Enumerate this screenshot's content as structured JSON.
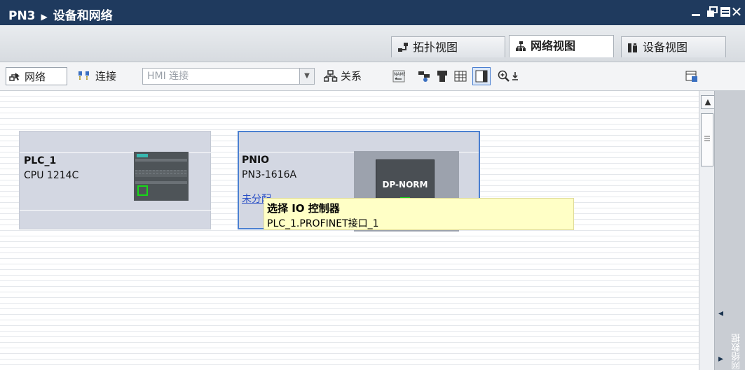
{
  "breadcrumb": {
    "project": "PN3",
    "page": "设备和网络"
  },
  "tabs": [
    {
      "label": "拓扑视图",
      "active": false
    },
    {
      "label": "网络视图",
      "active": true
    },
    {
      "label": "设备视图",
      "active": false
    }
  ],
  "toolbar": {
    "network_label": "网络",
    "connection_label": "连接",
    "hmi_placeholder": "HMI 连接",
    "relation_label": "关系"
  },
  "devices": [
    {
      "name": "PLC_1",
      "type": "CPU 1214C"
    },
    {
      "name": "PNIO",
      "type": "PN3-1616A",
      "link": "未分配",
      "module_label": "DP-NORM"
    }
  ],
  "tooltip": {
    "title": "选择 IO 控制器",
    "value": "PLC_1.PROFINET接口_1"
  },
  "side_panel_label": "网络数据",
  "colors": {
    "titlebar": "#1f3a5e",
    "device_bg": "#d3d7e2",
    "selection": "#4a7fd1",
    "tooltip_bg": "#ffffc6",
    "link": "#2a4fc5"
  }
}
